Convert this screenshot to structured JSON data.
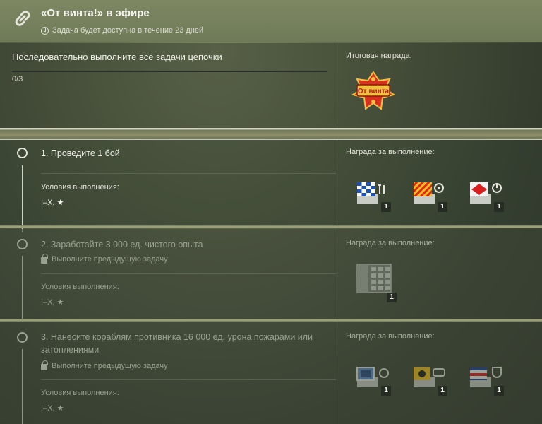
{
  "header": {
    "title": "«От винта!» в эфире",
    "timer": "Задача будет доступна в течение 23 дней"
  },
  "chain": {
    "instruction": "Последовательно выполните все задачи цепочки",
    "progress_text": "0/3",
    "progress_fraction": 0,
    "final_reward_label": "Итоговая награда:",
    "badge_text": "От винта"
  },
  "tasks": [
    {
      "title": "1. Проведите 1 бой",
      "locked": false,
      "conditions_label": "Условия выполнения:",
      "conditions": "I–X, ★",
      "reward_label": "Награда за выполнение:",
      "rewards": [
        {
          "icon": "signal-flag-blue-white-icon",
          "count": "1"
        },
        {
          "icon": "signal-flag-red-yellow-icon",
          "count": "1"
        },
        {
          "icon": "signal-flag-red-white-icon",
          "count": "1"
        }
      ]
    },
    {
      "title": "2. Заработайте 3 000 ед. чистого опыта",
      "locked": true,
      "lock_text": "Выполните предыдущую задачу",
      "conditions_label": "Условия выполнения:",
      "conditions": "I–X, ★",
      "reward_label": "Награда за выполнение:",
      "rewards": [
        {
          "icon": "container-icon",
          "count": "1"
        }
      ]
    },
    {
      "title": "3. Нанесите кораблям противника 16 000 ед. урона пожарами или затоплениями",
      "locked": true,
      "lock_text": "Выполните предыдущую задачу",
      "conditions_label": "Условия выполнения:",
      "conditions": "I–X, ★",
      "reward_label": "Награда за выполнение:",
      "rewards": [
        {
          "icon": "camouflage-blue-icon",
          "count": "1"
        },
        {
          "icon": "camouflage-yellow-icon",
          "count": "1"
        },
        {
          "icon": "signal-flag-striped-icon",
          "count": "1"
        }
      ]
    }
  ],
  "colors": {
    "accent": "#cfd2bf",
    "background": "#4a5440",
    "badge_red": "#c8281e",
    "badge_gold": "#e8b830"
  }
}
